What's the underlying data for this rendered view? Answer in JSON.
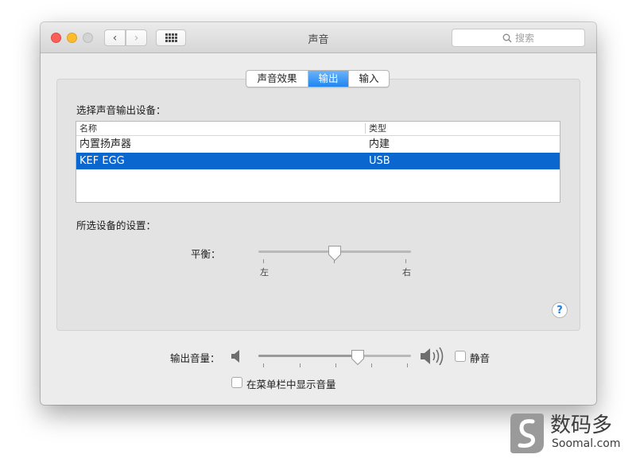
{
  "window": {
    "title": "声音",
    "search_placeholder": "搜索"
  },
  "tabs": [
    {
      "label": "声音效果",
      "active": false
    },
    {
      "label": "输出",
      "active": true
    },
    {
      "label": "输入",
      "active": false
    }
  ],
  "device_section": {
    "heading": "选择声音输出设备：",
    "columns": [
      "名称",
      "类型"
    ],
    "rows": [
      {
        "name": "内置扬声器",
        "type": "内建",
        "selected": false
      },
      {
        "name": "KEF EGG",
        "type": "USB",
        "selected": true
      }
    ]
  },
  "settings_section": {
    "heading": "所选设备的设置：",
    "balance_label": "平衡：",
    "left_label": "左",
    "right_label": "右",
    "balance_value": 0.5
  },
  "output_volume": {
    "label": "输出音量：",
    "value": 0.66,
    "mute_label": "静音",
    "mute_checked": false
  },
  "show_in_menubar": {
    "label": "在菜单栏中显示音量",
    "checked": false
  },
  "watermark": {
    "cn": "数码多",
    "en": "Soomal.com"
  },
  "colors": {
    "accent": "#1e86f0",
    "selection": "#0a67d0",
    "help": "#1e7de6"
  }
}
